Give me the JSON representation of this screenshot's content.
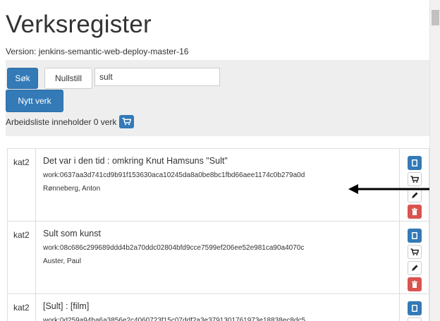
{
  "header": {
    "title": "Verksregister",
    "version": "Version: jenkins-semantic-web-deploy-master-16"
  },
  "search": {
    "search_label": "Søk",
    "reset_label": "Nullstill",
    "query_value": "sult",
    "new_work_label": "Nytt verk",
    "worklist_text": "Arbeidsliste inneholder 0 verk"
  },
  "results": [
    {
      "category": "kat2",
      "title": "Det var i den tid : omkring Knut Hamsuns \"Sult\"",
      "work_id": "work:0637aa3d741cd9b91f153630aca10245da8a0be8bc1fbd66aee1174c0b279a0d",
      "author": "Rønneberg, Anton"
    },
    {
      "category": "kat2",
      "title": "Sult som kunst",
      "work_id": "work:08c686c299689ddd4b2a70ddc02804bfd9cce7599ef206ee52e981ca90a4070c",
      "author": "Auster, Paul"
    },
    {
      "category": "kat2",
      "title": "[Sult] : [film]",
      "work_id": "work:0d259a94ba6a3856e2c4060723f15c07ddf2a3e3791301761973e18838ec8dc5",
      "author": ""
    }
  ],
  "colors": {
    "primary": "#337ab7",
    "danger": "#d9534f",
    "panel": "#eeeeee"
  },
  "icons": {
    "copy": "copy-icon",
    "cart": "cart-icon",
    "edit": "pencil-icon",
    "delete": "trash-icon"
  }
}
